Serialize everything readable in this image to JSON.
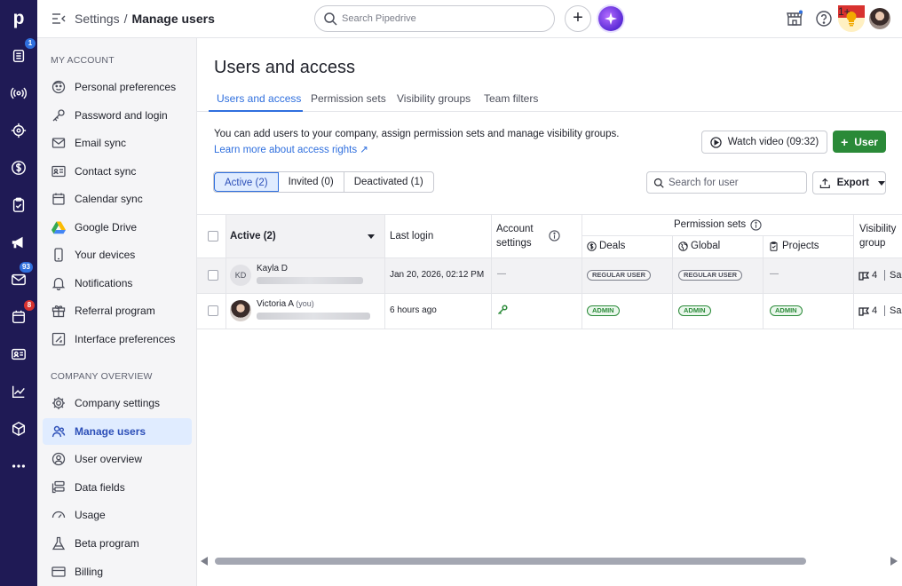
{
  "app": {
    "logo_letter": "p",
    "rail": [
      {
        "icon": "leads-inbox-icon",
        "badge": "1"
      },
      {
        "icon": "activity-radar-icon"
      },
      {
        "icon": "target-icon"
      },
      {
        "icon": "deals-dollar-icon"
      },
      {
        "icon": "tasks-clipboard-icon"
      },
      {
        "icon": "campaigns-megaphone-icon"
      },
      {
        "icon": "mail-icon",
        "badge": "93"
      },
      {
        "icon": "calendar-icon",
        "badge": "8"
      },
      {
        "icon": "contacts-card-icon"
      },
      {
        "icon": "insights-chart-icon"
      },
      {
        "icon": "products-box-icon"
      },
      {
        "icon": "more-icon"
      }
    ]
  },
  "topbar": {
    "breadcrumb_parent": "Settings",
    "breadcrumb_sep": "/",
    "breadcrumb_current": "Manage users",
    "search_placeholder": "Search Pipedrive",
    "plus_label": "+",
    "bulb_badge": "1+"
  },
  "sidebar": {
    "my_account_title": "MY ACCOUNT",
    "my_account": [
      {
        "label": "Personal preferences",
        "icon": "face-icon"
      },
      {
        "label": "Password and login",
        "icon": "key-icon"
      },
      {
        "label": "Email sync",
        "icon": "envelope-icon"
      },
      {
        "label": "Contact sync",
        "icon": "contact-card-icon"
      },
      {
        "label": "Calendar sync",
        "icon": "calendar-icon"
      },
      {
        "label": "Google Drive",
        "icon": "google-drive-icon"
      },
      {
        "label": "Your devices",
        "icon": "phone-icon"
      },
      {
        "label": "Notifications",
        "icon": "bell-icon"
      },
      {
        "label": "Referral program",
        "icon": "gift-icon"
      },
      {
        "label": "Interface preferences",
        "icon": "interface-icon"
      }
    ],
    "company_title": "COMPANY OVERVIEW",
    "company": [
      {
        "label": "Company settings",
        "icon": "gear-icon"
      },
      {
        "label": "Manage users",
        "icon": "users-icon",
        "active": true
      },
      {
        "label": "User overview",
        "icon": "user-circle-icon"
      },
      {
        "label": "Data fields",
        "icon": "data-fields-icon"
      },
      {
        "label": "Usage",
        "icon": "gauge-icon"
      },
      {
        "label": "Beta program",
        "icon": "flask-icon"
      },
      {
        "label": "Billing",
        "icon": "credit-card-icon"
      }
    ]
  },
  "main": {
    "title": "Users and access",
    "tabs": [
      "Users and access",
      "Permission sets",
      "Visibility groups",
      "Team filters"
    ],
    "description": "You can add users to your company, assign permission sets and manage visibility groups.",
    "learn_link": "Learn more about access rights ↗",
    "watch_video": "Watch video (09:32)",
    "add_user": "User",
    "add_user_plus": "+",
    "filters": [
      "Active (2)",
      "Invited (0)",
      "Deactivated (1)"
    ],
    "search_user_placeholder": "Search for user",
    "export_label": "Export"
  },
  "table": {
    "col_active": "Active (2)",
    "col_last_login": "Last login",
    "col_account_settings_1": "Account",
    "col_account_settings_2": "settings",
    "col_permission_sets": "Permission sets",
    "col_deals": "Deals",
    "col_global": "Global",
    "col_projects": "Projects",
    "col_visibility_1": "Visibility",
    "col_visibility_2": "group",
    "rows": [
      {
        "initials": "KD",
        "name": "Kayla D",
        "you": "",
        "last_login": "Jan 20, 2026, 02:12 PM",
        "account_settings": "—",
        "deals": "REGULAR USER",
        "global": "REGULAR USER",
        "projects": "—",
        "visibility": "4",
        "visibility_tail": "Sa"
      },
      {
        "initials": "",
        "name": "Victoria A",
        "you": "(you)",
        "last_login": "6 hours ago",
        "account_settings": "",
        "deals": "ADMIN",
        "global": "ADMIN",
        "projects": "ADMIN",
        "visibility": "4",
        "visibility_tail": "Sa"
      }
    ]
  },
  "colors": {
    "rail": "#1f1a55",
    "accent_blue": "#2f6fde",
    "primary_green": "#2a8a38",
    "active_nav_bg": "#e0ecff"
  }
}
